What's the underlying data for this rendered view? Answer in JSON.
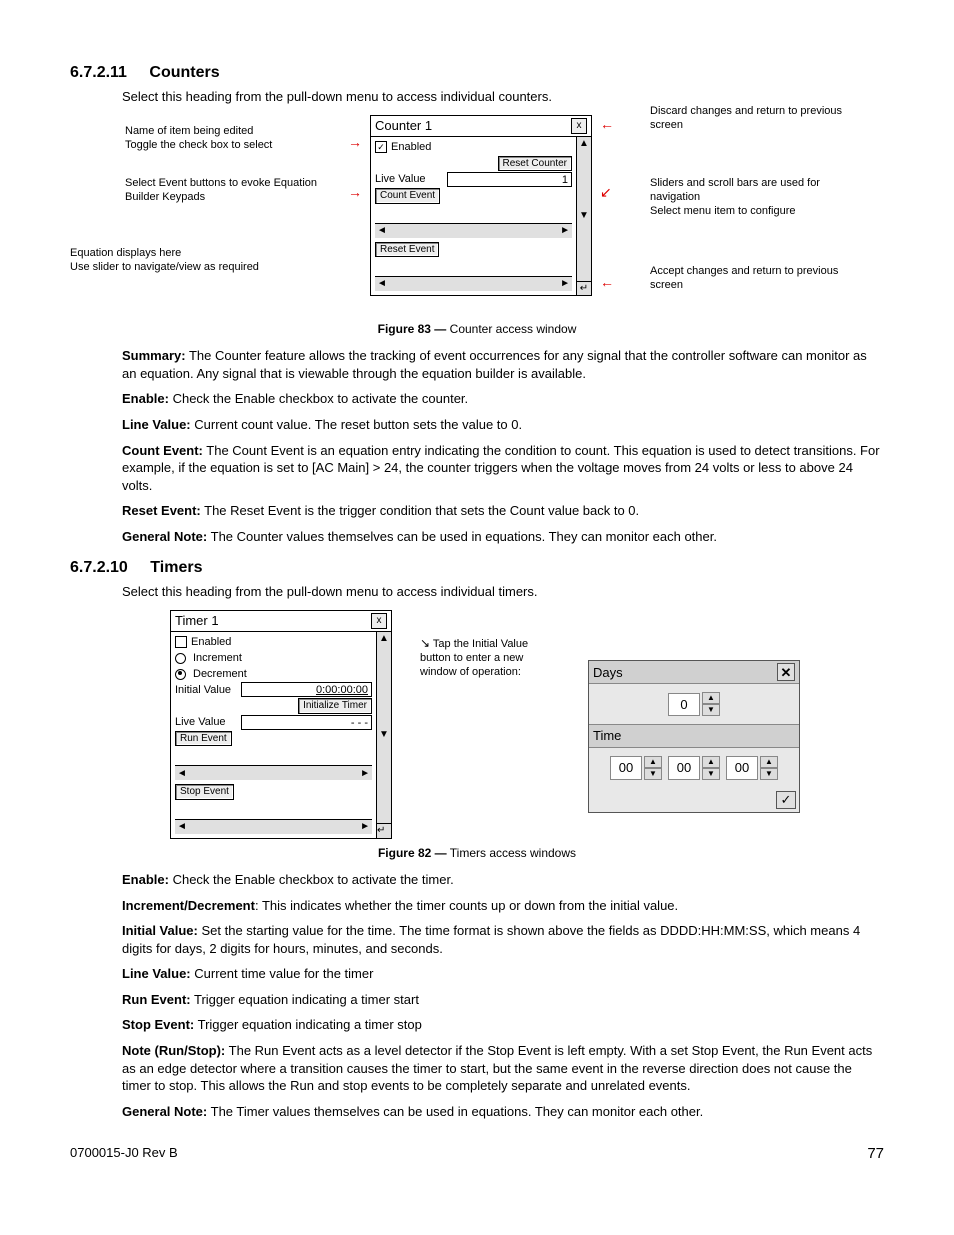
{
  "section1": {
    "num": "6.7.2.11",
    "title": "Counters",
    "intro": "Select this heading from the pull-down menu to access individual counters."
  },
  "fig83": {
    "caption_bold": "Figure 83  —",
    "caption": "  Counter access window",
    "annL1": "Name of item being edited\nToggle the check box to select",
    "annL2": "Select Event buttons  to evoke Equation Builder Keypads",
    "annL3": "Equation displays here\nUse slider to navigate/view as required",
    "annR1": "Discard changes and return to previous screen",
    "annR2": "Sliders and scroll bars are used for navigation\nSelect menu item to configure",
    "annR3": "Accept changes and return to previous screen",
    "panel": {
      "title": "Counter 1",
      "enabled_label": "Enabled",
      "reset_counter": "Reset Counter",
      "live_value_label": "Live Value",
      "live_value": "1",
      "count_event": "Count Event",
      "reset_event": "Reset Event"
    }
  },
  "counters_paras": [
    {
      "b": "Summary:",
      "t": " The Counter feature allows the tracking of event occurrences for any signal that the controller software can monitor as an equation. Any signal that is viewable through the equation builder is available."
    },
    {
      "b": "Enable:",
      "t": " Check the Enable checkbox to activate the counter."
    },
    {
      "b": "Line Value:",
      "t": " Current count value. The reset button sets the value to 0."
    },
    {
      "b": "Count Event:",
      "t": " The Count Event is an equation entry indicating the condition to count. This equation is used to detect transitions. For example, if the equation is set to [AC Main] > 24, the counter triggers when the voltage moves from 24 volts or less to above 24 volts."
    },
    {
      "b": "Reset Event:",
      "t": " The Reset Event is the trigger condition that sets the Count value back to 0."
    },
    {
      "b": "General Note:",
      "t": " The Counter values themselves can be used in equations. They can monitor each other."
    }
  ],
  "section2": {
    "num": "6.7.2.10",
    "title": "Timers",
    "intro": "Select this heading from the pull-down menu to access individual timers."
  },
  "fig82": {
    "caption_bold": "Figure 82  —",
    "caption": "  Timers access windows",
    "callout": "Tap the Initial Value button to enter a new window of operation:",
    "timer": {
      "title": "Timer 1",
      "enabled": "Enabled",
      "increment": "Increment",
      "decrement": "Decrement",
      "initial_label": "Initial Value",
      "initial_value": "0:00:00:00",
      "init_btn": "Initialize Timer",
      "live_label": "Live Value",
      "live_value": "- - -",
      "run_event": "Run Event",
      "stop_event": "Stop Event"
    },
    "days": {
      "days_label": "Days",
      "days_value": "0",
      "time_label": "Time",
      "h": "00",
      "m": "00",
      "s": "00"
    }
  },
  "timers_paras": [
    {
      "b": "Enable:",
      "t": " Check the Enable checkbox to activate the timer."
    },
    {
      "b": "Increment/Decrement",
      "t": ": This indicates whether the timer counts up or down from the initial value."
    },
    {
      "b": "Initial Value:",
      "t": " Set the starting value for the time. The time format is shown above the fields as DDDD:HH:MM:SS, which means 4 digits for days, 2 digits for hours, minutes, and seconds."
    },
    {
      "b": "Line Value:",
      "t": " Current time value for the timer"
    },
    {
      "b": "Run Event:",
      "t": " Trigger equation indicating a timer start"
    },
    {
      "b": "Stop Event:",
      "t": " Trigger equation indicating a timer stop"
    },
    {
      "b": "Note (Run/Stop):",
      "t": " The Run Event acts as a level detector if the Stop Event is left empty. With a set Stop Event, the Run Event acts as an edge detector where a transition causes the timer to start, but the same event in the reverse direction does not cause the timer to stop. This allows the Run and stop events to be completely separate and unrelated events."
    },
    {
      "b": "General Note:",
      "t": " The Timer values themselves can be used in equations. They can monitor each other."
    }
  ],
  "footer": {
    "left": "0700015-J0    Rev B",
    "right": "77"
  }
}
